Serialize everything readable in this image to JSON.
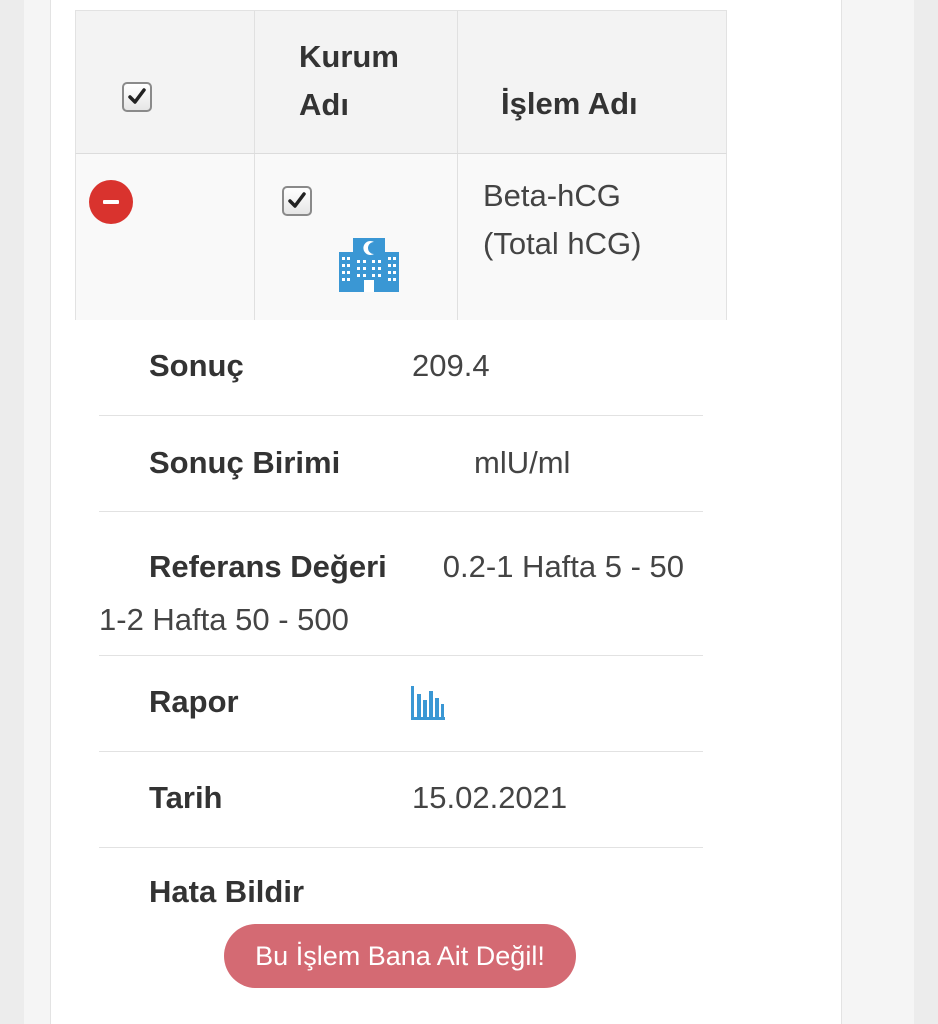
{
  "table": {
    "headers": {
      "kurum_line1": "Kurum",
      "kurum_line2": "Adı",
      "islem": "İşlem Adı"
    },
    "row": {
      "islem_line1": "Beta-hCG",
      "islem_line2": "(Total hCG)",
      "kurum_icon": "hospital-building-icon"
    }
  },
  "details": {
    "sonuc": {
      "label": "Sonuç",
      "value": "209.4"
    },
    "sonuc_birimi": {
      "label": "Sonuç Birimi",
      "value": "mlU/ml"
    },
    "referans": {
      "label": "Referans Değeri",
      "value": "0.2-1 Hafta 5 - 50 1-2 Hafta 50 - 500"
    },
    "rapor": {
      "label": "Rapor",
      "icon": "bar-chart-icon"
    },
    "tarih": {
      "label": "Tarih",
      "value": "15.02.2021"
    },
    "hata": {
      "label": "Hata Bildir",
      "button": "Bu İşlem Bana Ait Değil!"
    }
  },
  "colors": {
    "accent_blue": "#3a97d4",
    "remove_red": "#d9332e",
    "error_button": "#d46a73"
  }
}
